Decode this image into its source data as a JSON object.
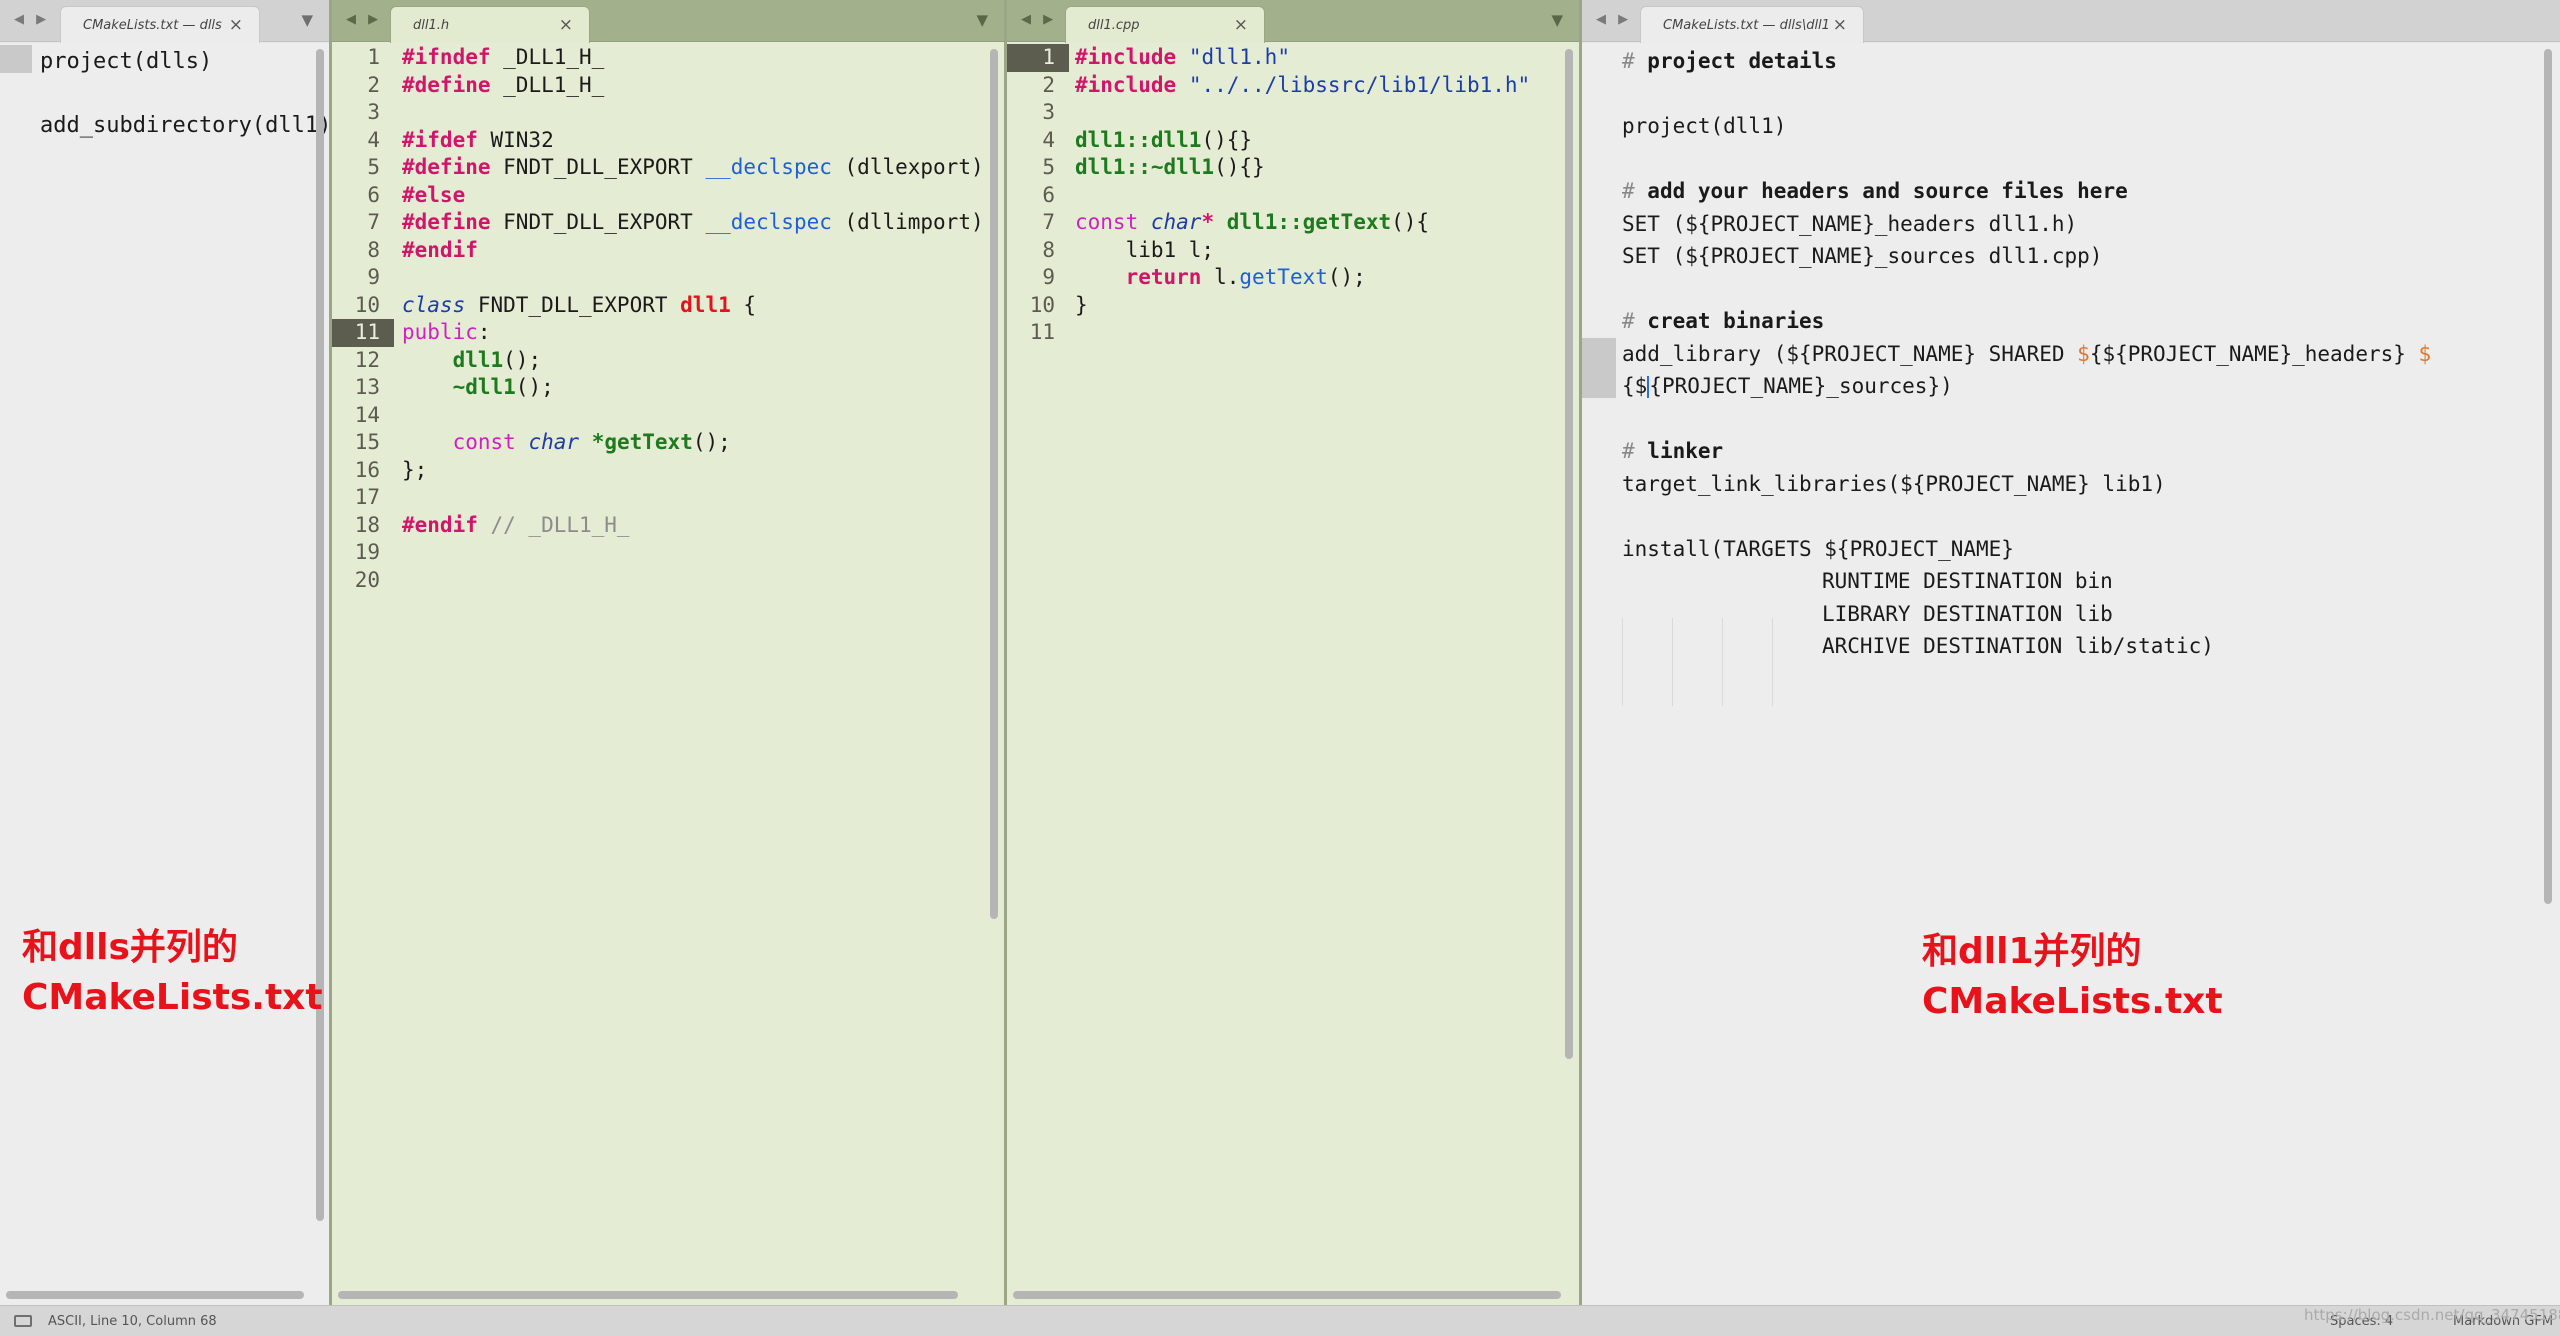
{
  "panes": [
    {
      "tab": "CMakeLists.txt — dlls",
      "close": "×"
    },
    {
      "tab": "dll1.h",
      "close": "×"
    },
    {
      "tab": "dll1.cpp",
      "close": "×"
    },
    {
      "tab": "CMakeLists.txt — dlls\\dll1",
      "close": "×"
    }
  ],
  "nav_arrows": "◀ ▶",
  "dropdown": "▼",
  "pane1": {
    "lines": [
      "project(dlls)",
      "",
      "add_subdirectory(dll1)"
    ]
  },
  "pane2": {
    "line_numbers": [
      "1",
      "2",
      "3",
      "4",
      "5",
      "6",
      "7",
      "8",
      "9",
      "10",
      "11",
      "12",
      "13",
      "14",
      "15",
      "16",
      "17",
      "18",
      "19",
      "20"
    ],
    "l1a": "#ifndef",
    "l1b": " _DLL1_H_",
    "l2a": "#define",
    "l2b": " _DLL1_H_",
    "l4a": "#ifdef",
    "l4b": " WIN32",
    "l5a": "#define",
    "l5b": " FNDT_DLL_EXPORT ",
    "l5c": "__declspec",
    "l5d": " (dllexport)",
    "l6a": "#else",
    "l7a": "#define",
    "l7b": " FNDT_DLL_EXPORT ",
    "l7c": "__declspec",
    "l7d": " (dllimport)",
    "l8a": "#endif",
    "l10a": "class",
    "l10b": " FNDT_DLL_EXPORT ",
    "l10c": "dll1",
    "l10d": " {",
    "l11a": "public",
    "l11b": ":",
    "l12a": "    ",
    "l12b": "dll1",
    "l12c": "();",
    "l13a": "    ",
    "l13b": "~dll1",
    "l13c": "();",
    "l15a": "    ",
    "l15b": "const",
    "l15c": " ",
    "l15d": "char",
    "l15e": " ",
    "l15f": "*getText",
    "l15g": "();",
    "l16a": "};",
    "l18a": "#endif",
    "l18b": " // _DLL1_H_"
  },
  "pane3": {
    "line_numbers": [
      "1",
      "2",
      "3",
      "4",
      "5",
      "6",
      "7",
      "8",
      "9",
      "10",
      "11"
    ],
    "l1a": "#include",
    "l1b": " ",
    "l1c": "\"dll1.h\"",
    "l2a": "#include",
    "l2b": " ",
    "l2c": "\"../../libssrc/lib1/lib1.h\"",
    "l4a": "dll1::dll1",
    "l4b": "(){}",
    "l5a": "dll1::~dll1",
    "l5b": "(){}",
    "l7a": "const",
    "l7b": " ",
    "l7c": "char",
    "l7d": "*",
    "l7e": " ",
    "l7f": "dll1::getText",
    "l7g": "(){",
    "l8a": "    lib1 l;",
    "l9a": "    ",
    "l9b": "return",
    "l9c": " l.",
    "l9d": "getText",
    "l9e": "();",
    "l10a": "}"
  },
  "pane4": {
    "c1a": "# ",
    "c1b": "project details",
    "l3": "project(dll1)",
    "c5a": "# ",
    "c5b": "add your headers and source files here",
    "l6": "SET (${PROJECT_NAME}_headers dll1.h)",
    "l7": "SET (${PROJECT_NAME}_sources dll1.cpp)",
    "c9a": "# ",
    "c9b": "creat binaries",
    "l10a": "add_library (${PROJECT_NAME} SHARED ",
    "l10b": "$",
    "l10c": "{${PROJECT_NAME}_headers}",
    "l10d": " ",
    "l10e": "$",
    "l11a": "{$",
    "l11b": "{PROJECT_NAME}_sources})",
    "c13a": "# ",
    "c13b": "linker",
    "l14": "target_link_libraries(${PROJECT_NAME} lib1)",
    "l16": "install(TARGETS ${PROJECT_NAME}",
    "l17": "RUNTIME DESTINATION bin",
    "l18": "LIBRARY DESTINATION lib",
    "l19": "ARCHIVE DESTINATION lib/static)"
  },
  "annotations": {
    "left_1": "和dlls并列的",
    "left_2": "CMakeLists.txt",
    "right_1": "和dll1并列的",
    "right_2": "CMakeLists.txt",
    "color": "#e8121a"
  },
  "status": {
    "text": "ASCII, Line 10, Column 68",
    "spaces": "Spaces: 4",
    "syntax": "Markdown GFM"
  },
  "watermark": "https://blog.csdn.net/qq_34745188",
  "colors": {
    "green_bg": "#e5ecd4",
    "gray_bg": "#ededed",
    "preproc": "#d1156a",
    "accent_blue": "#1f5fd6"
  }
}
